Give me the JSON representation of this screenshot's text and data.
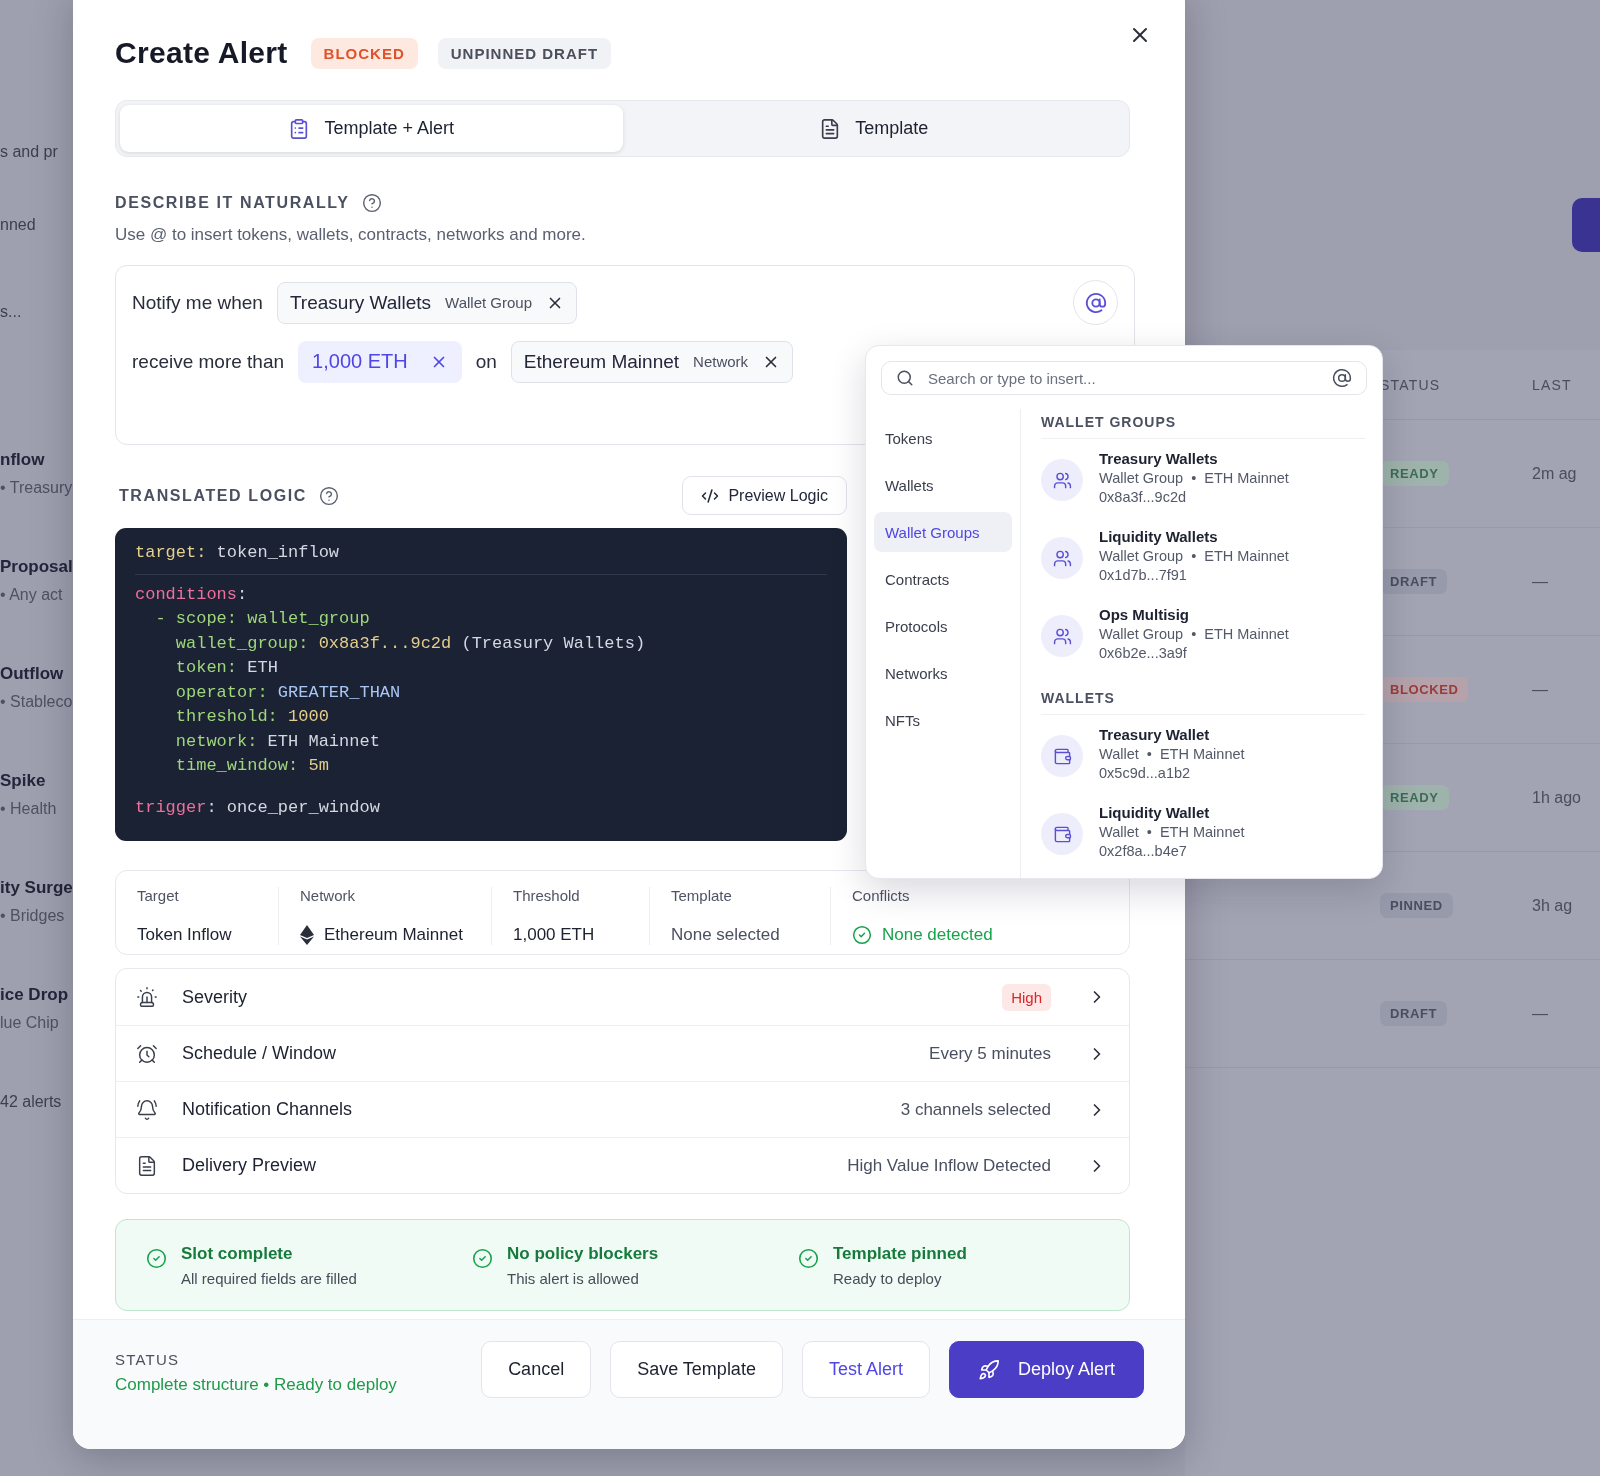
{
  "background": {
    "left_panel": {
      "header_texts": [
        "s and pr",
        "nned",
        "s..."
      ],
      "items": [
        {
          "title": "nflow",
          "subtitle": "• Treasury"
        },
        {
          "title": "Proposal",
          "subtitle": "• Any act"
        },
        {
          "title": "Outflow",
          "subtitle": "• Stableco"
        },
        {
          "title": "Spike",
          "subtitle": "• Health"
        },
        {
          "title": "ity Surge",
          "subtitle": "• Bridges"
        },
        {
          "title": "ice Drop",
          "subtitle": "lue Chip"
        }
      ],
      "footer": "42 alerts"
    },
    "table": {
      "columns": [
        "STATUS",
        "LAST"
      ],
      "rows": [
        {
          "status": "READY",
          "kind": "ready",
          "last": "2m ag"
        },
        {
          "status": "DRAFT",
          "kind": "neutral",
          "last": "—"
        },
        {
          "status": "BLOCKED",
          "kind": "blocked",
          "last": "—"
        },
        {
          "status": "READY",
          "kind": "ready",
          "last": "1h ago"
        },
        {
          "status": "PINNED",
          "kind": "neutral",
          "last": "3h ag"
        },
        {
          "status": "DRAFT",
          "kind": "neutral",
          "last": "—"
        }
      ]
    }
  },
  "modal": {
    "title": "Create Alert",
    "badges": [
      {
        "label": "BLOCKED",
        "kind": "danger"
      },
      {
        "label": "UNPINNED DRAFT",
        "kind": "neutral"
      }
    ],
    "tabs": [
      {
        "label": "Template + Alert",
        "selected": true
      },
      {
        "label": "Template",
        "selected": false
      }
    ],
    "describe": {
      "heading": "DESCRIBE IT NATURALLY",
      "hint": "Use @ to insert tokens, wallets, contracts, networks and more."
    },
    "composer": {
      "lines": [
        [
          {
            "kind": "text",
            "text": "Notify me when"
          },
          {
            "kind": "chip",
            "label": "Treasury Wallets",
            "type": "Wallet Group"
          }
        ],
        [
          {
            "kind": "text",
            "text": "receive more than"
          },
          {
            "kind": "value",
            "label": "1,000 ETH"
          },
          {
            "kind": "text",
            "text": "on"
          },
          {
            "kind": "chip",
            "label": "Ethereum Mainnet",
            "type": "Network"
          }
        ]
      ]
    },
    "logic": {
      "heading": "TRANSLATED LOGIC",
      "preview_button": "Preview Logic",
      "target": [
        {
          "text": "target:",
          "kind": "label"
        },
        {
          "text": " token_inflow",
          "kind": "plain"
        }
      ],
      "conditions": [
        [
          {
            "text": "conditions",
            "kind": "section"
          },
          {
            "text": ":",
            "kind": "plain"
          }
        ],
        [
          {
            "text": "  - scope:",
            "kind": "key"
          },
          {
            "text": " wallet_group",
            "kind": "key"
          }
        ],
        [
          {
            "text": "    wallet_group:",
            "kind": "key"
          },
          {
            "text": " 0x8a3f...9c2d",
            "kind": "literal"
          },
          {
            "text": " (Treasury Wallets)",
            "kind": "plain"
          }
        ],
        [
          {
            "text": "    token:",
            "kind": "key"
          },
          {
            "text": " ETH",
            "kind": "plain"
          }
        ],
        [
          {
            "text": "    operator:",
            "kind": "key"
          },
          {
            "text": " GREATER_THAN",
            "kind": "enum"
          }
        ],
        [
          {
            "text": "    threshold:",
            "kind": "key"
          },
          {
            "text": " 1000",
            "kind": "literal"
          }
        ],
        [
          {
            "text": "    network:",
            "kind": "key"
          },
          {
            "text": " ETH Mainnet",
            "kind": "plain"
          }
        ],
        [
          {
            "text": "    time_window:",
            "kind": "key"
          },
          {
            "text": " 5m",
            "kind": "literal"
          }
        ]
      ],
      "trigger": [
        {
          "text": "trigger",
          "kind": "section"
        },
        {
          "text": ": once_per_window",
          "kind": "plain"
        }
      ]
    },
    "summary": [
      {
        "label": "Target",
        "value": "Token Inflow",
        "kind": "plain"
      },
      {
        "label": "Network",
        "value": "Ethereum Mainnet",
        "kind": "network"
      },
      {
        "label": "Threshold",
        "value": "1,000 ETH",
        "kind": "plain"
      },
      {
        "label": "Template",
        "value": "None selected",
        "kind": "muted"
      },
      {
        "label": "Conflicts",
        "value": "None detected",
        "kind": "ok"
      }
    ],
    "settings": [
      {
        "label": "Severity",
        "value": "High",
        "kind": "badge"
      },
      {
        "label": "Schedule / Window",
        "value": "Every 5 minutes",
        "kind": "text"
      },
      {
        "label": "Notification Channels",
        "value": "3 channels selected",
        "kind": "text"
      },
      {
        "label": "Delivery Preview",
        "value": "High Value Inflow Detected",
        "kind": "text"
      }
    ],
    "checks": [
      {
        "title": "Slot complete",
        "detail": "All required fields are filled"
      },
      {
        "title": "No policy blockers",
        "detail": "This alert is allowed"
      },
      {
        "title": "Template pinned",
        "detail": "Ready to deploy"
      }
    ],
    "footer": {
      "status_label": "STATUS",
      "status_text": "Complete structure • Ready to deploy",
      "buttons": [
        {
          "label": "Cancel",
          "kind": "secondary"
        },
        {
          "label": "Save Template",
          "kind": "secondary"
        },
        {
          "label": "Test Alert",
          "kind": "outline"
        },
        {
          "label": "Deploy Alert",
          "kind": "primary"
        }
      ]
    },
    "insert_menu": {
      "search_placeholder": "Search or type to insert...",
      "categories": [
        {
          "label": "Tokens",
          "selected": false
        },
        {
          "label": "Wallets",
          "selected": false
        },
        {
          "label": "Wallet Groups",
          "selected": true
        },
        {
          "label": "Contracts",
          "selected": false
        },
        {
          "label": "Protocols",
          "selected": false
        },
        {
          "label": "Networks",
          "selected": false
        },
        {
          "label": "NFTs",
          "selected": false
        }
      ],
      "sections": [
        {
          "heading": "WALLET GROUPS",
          "kind": "group",
          "items": [
            {
              "name": "Treasury Wallets",
              "meta": "Wallet Group  •  ETH Mainnet",
              "address": "0x8a3f...9c2d"
            },
            {
              "name": "Liquidity Wallets",
              "meta": "Wallet Group  •  ETH Mainnet",
              "address": "0x1d7b...7f91"
            },
            {
              "name": "Ops Multisig",
              "meta": "Wallet Group  •  ETH Mainnet",
              "address": "0x6b2e...3a9f"
            }
          ]
        },
        {
          "heading": "WALLETS",
          "kind": "wallet",
          "items": [
            {
              "name": "Treasury Wallet",
              "meta": "Wallet  •  ETH Mainnet",
              "address": "0x5c9d...a1b2"
            },
            {
              "name": "Liquidity Wallet",
              "meta": "Wallet  •  ETH Mainnet",
              "address": "0x2f8a...b4e7"
            }
          ]
        }
      ]
    }
  }
}
